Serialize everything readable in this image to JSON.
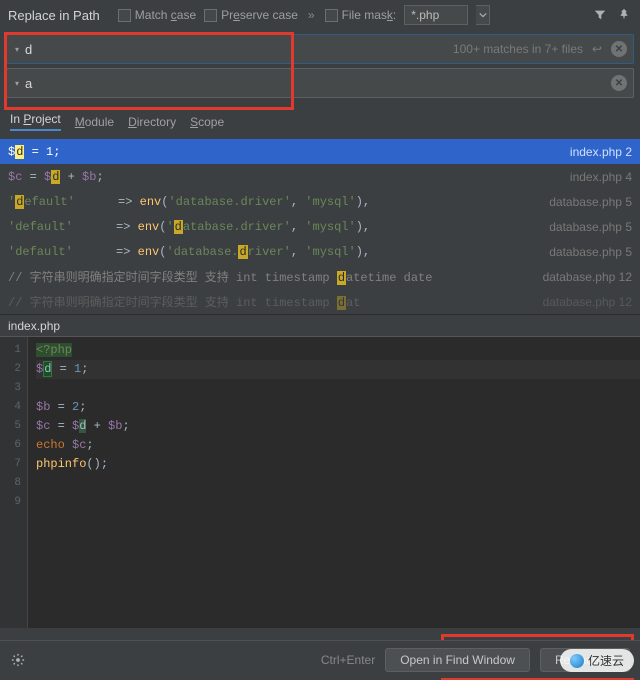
{
  "title": "Replace in Path",
  "match_case": "Match case",
  "preserve_case": "Preserve case",
  "file_mask_label": "File mask:",
  "file_mask_value": "*.php",
  "search_value": "d",
  "replace_value": "a",
  "search_status": "100+ matches in 7+ files",
  "scopes": {
    "in_project": "In Project",
    "module": "Module",
    "directory": "Directory",
    "scope": "Scope"
  },
  "results": [
    {
      "file": "index.php",
      "line": "2"
    },
    {
      "file": "index.php",
      "line": "4"
    },
    {
      "file": "database.php",
      "line": "5"
    },
    {
      "file": "database.php",
      "line": "5"
    },
    {
      "file": "database.php",
      "line": "5"
    },
    {
      "file": "database.php",
      "line": "12"
    },
    {
      "file": "database.php",
      "line": "12"
    }
  ],
  "preview_file": "index.php",
  "editor_lines": [
    "1",
    "2",
    "3",
    "4",
    "5",
    "6",
    "7",
    "8",
    "9"
  ],
  "hint": "Ctrl+Enter",
  "buttons": {
    "open": "Open in Find Window",
    "replace_all": "Replace All"
  },
  "watermark": "亿速云"
}
